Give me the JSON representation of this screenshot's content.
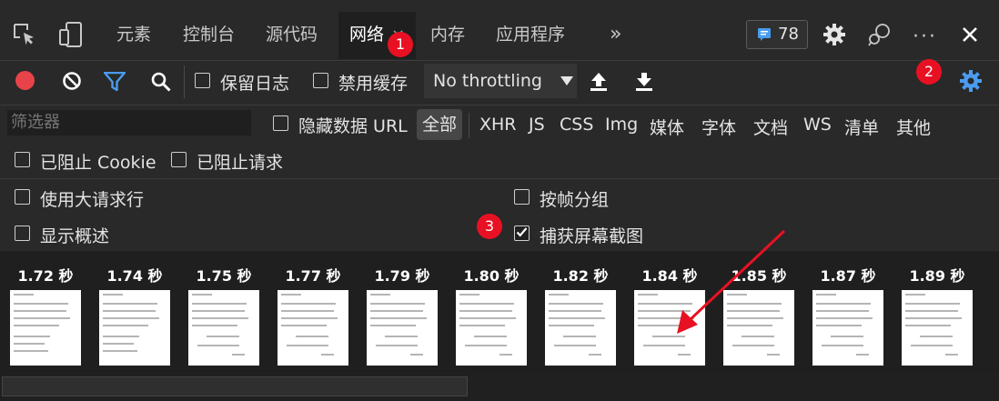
{
  "tabs": {
    "elements": "元素",
    "console": "控制台",
    "sources": "源代码",
    "network": "网络",
    "network_close": "×",
    "memory": "内存",
    "application": "应用程序",
    "more": "»"
  },
  "issues_count": "78",
  "annotations": {
    "one": "1",
    "two": "2",
    "three": "3"
  },
  "toolbar": {
    "preserve_log": "保留日志",
    "disable_cache": "禁用缓存",
    "throttling": "No throttling"
  },
  "filter": {
    "placeholder": "筛选器",
    "hide_data_url": "隐藏数据 URL",
    "types": [
      "全部",
      "XHR",
      "JS",
      "CSS",
      "Img",
      "媒体",
      "字体",
      "文档",
      "WS",
      "清单",
      "其他"
    ],
    "blocked_cookies": "已阻止 Cookie",
    "blocked_requests": "已阻止请求"
  },
  "settings": {
    "large_rows": "使用大请求行",
    "group_by_frame": "按帧分组",
    "show_overview": "显示概述",
    "capture_screenshots": "捕获屏幕截图",
    "capture_screenshots_checked": true
  },
  "filmstrip": [
    "1.72 秒",
    "1.74 秒",
    "1.75 秒",
    "1.77 秒",
    "1.79 秒",
    "1.80 秒",
    "1.82 秒",
    "1.84 秒",
    "1.85 秒",
    "1.87 秒",
    "1.89 秒"
  ],
  "colors": {
    "record": "#e8434a",
    "accent": "#4a9cf0",
    "annotation": "#e81123"
  }
}
